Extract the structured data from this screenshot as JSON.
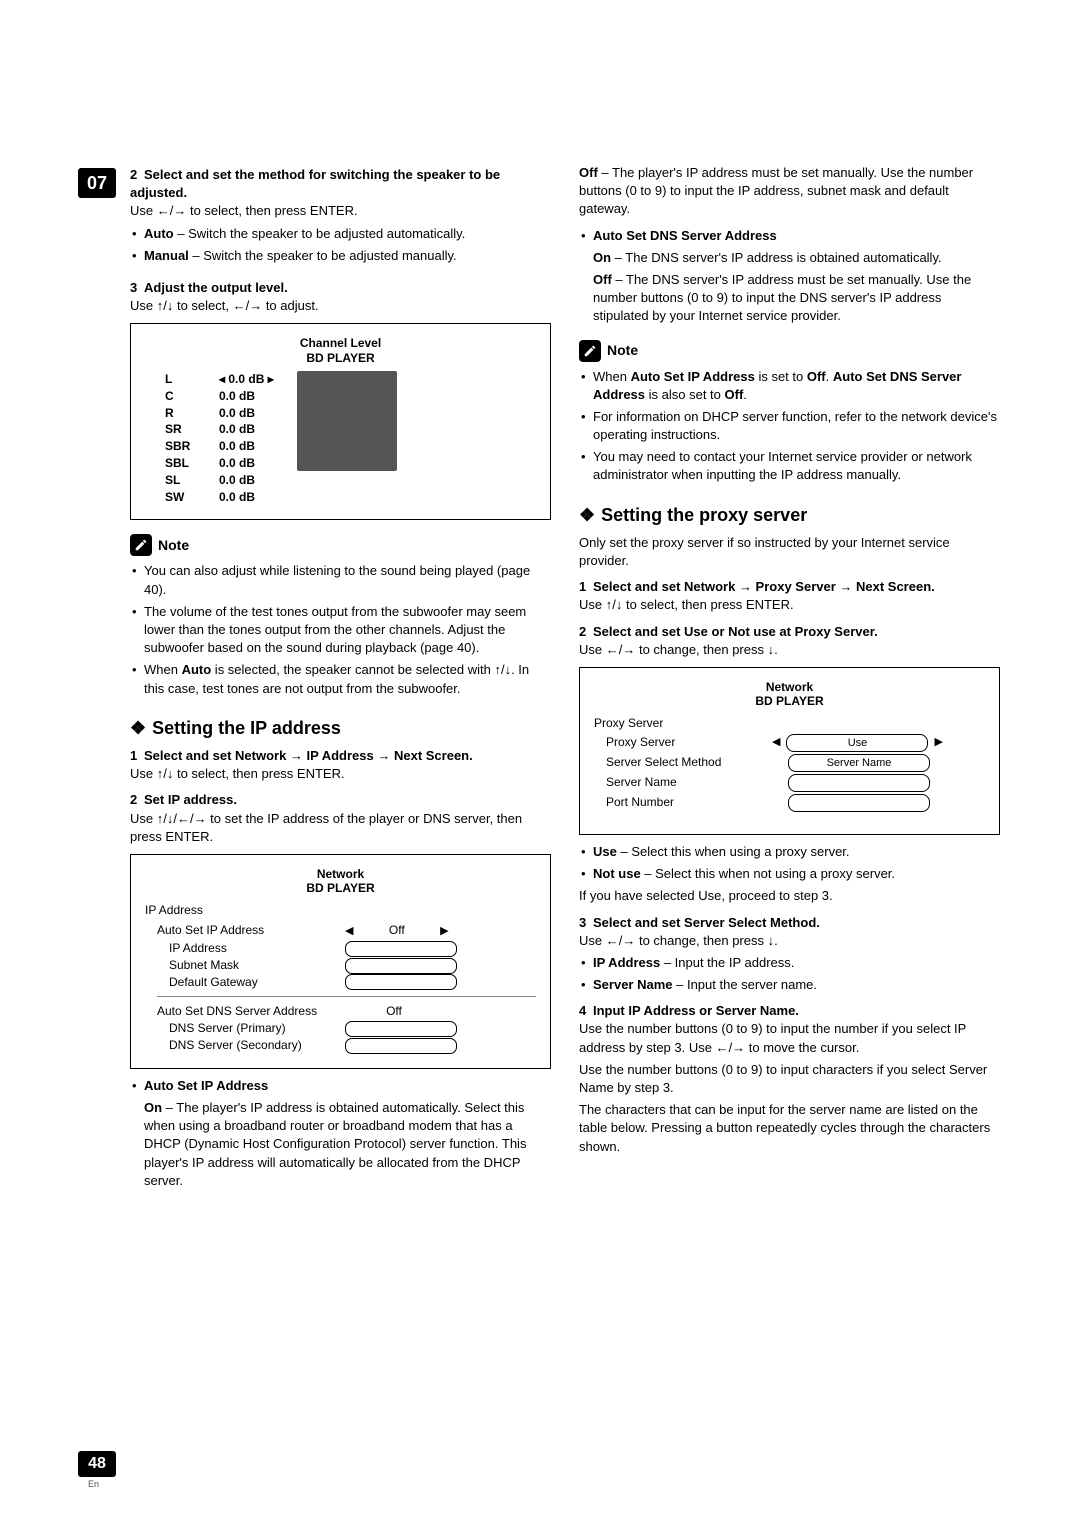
{
  "chapterNumber": "07",
  "pageNumber": "48",
  "pageLang": "En",
  "left": {
    "step2": {
      "num": "2",
      "title": "Select and set the method for switching the speaker to be adjusted."
    },
    "step2_instr": "Use ←/→ to select, then press ENTER.",
    "auto": {
      "label": "Auto",
      "desc": " – Switch the speaker to be adjusted automatically."
    },
    "manual": {
      "label": "Manual",
      "desc": " – Switch the speaker to be adjusted manually."
    },
    "step3": {
      "num": "3",
      "title": "Adjust the output level."
    },
    "step3_instr": "Use ↑/↓ to select, ←/→ to adjust.",
    "osd1": {
      "title1": "Channel Level",
      "title2": "BD PLAYER",
      "rows": [
        {
          "ch": "L",
          "val": "◂ 0.0 dB ▸"
        },
        {
          "ch": "C",
          "val": "0.0 dB"
        },
        {
          "ch": "R",
          "val": "0.0 dB"
        },
        {
          "ch": "SR",
          "val": "0.0 dB"
        },
        {
          "ch": "SBR",
          "val": "0.0 dB"
        },
        {
          "ch": "SBL",
          "val": "0.0 dB"
        },
        {
          "ch": "SL",
          "val": "0.0 dB"
        },
        {
          "ch": "SW",
          "val": "0.0 dB"
        }
      ]
    },
    "noteLabel": "Note",
    "note_b1": "You can also adjust while listening to the sound being played (page 40).",
    "note_b2": "The volume of the test tones output from the subwoofer may seem lower than the tones output from the other channels. Adjust the subwoofer based on the sound during playback (page 40).",
    "note_b3_a": "When ",
    "note_b3_b": "Auto",
    "note_b3_c": " is selected, the speaker cannot be selected with ↑/↓. In this case, test tones are not output from the subwoofer.",
    "h_ip": "Setting the IP address",
    "ip_s1": {
      "num": "1",
      "title": "Select and set Network → IP Address → Next Screen."
    },
    "ip_s1_instr": "Use ↑/↓ to select, then press ENTER.",
    "ip_s2": {
      "num": "2",
      "title": "Set IP address."
    },
    "ip_s2_instr": "Use ↑/↓/←/→ to set the IP address of the player or DNS server, then press ENTER.",
    "osd2": {
      "title1": "Network",
      "title2": "BD PLAYER",
      "group": "IP Address",
      "r1": "Auto Set IP Address",
      "r1v": "Off",
      "r2": "IP Address",
      "r3": "Subnet Mask",
      "r4": "Default Gateway",
      "r5": "Auto Set DNS Server Address",
      "r5v": "Off",
      "r6": "DNS Server (Primary)",
      "r7": "DNS Server (Secondary)"
    },
    "autosetip_label": "Auto Set IP Address",
    "on_label": "On",
    "on_desc": " – The player's IP address is obtained automatically. Select this when using a broadband router or broadband modem that has a DHCP (Dynamic Host Configuration Protocol) server function. This player's IP address will automatically be allocated from the DHCP server."
  },
  "right": {
    "off_label": "Off",
    "off_desc": " – The player's IP address must be set manually. Use the number buttons (0 to 9) to input the IP address, subnet mask and default gateway.",
    "dns_label": "Auto Set DNS Server Address",
    "dns_on": "On",
    "dns_on_desc": " – The DNS server's IP address is obtained automatically.",
    "dns_off": "Off",
    "dns_off_desc": " – The DNS server's IP address must be set manually. Use the number buttons (0 to 9) to input the DNS server's IP address stipulated by your Internet service provider.",
    "noteLabel": "Note",
    "n1_a": "When ",
    "n1_b": "Auto Set IP Address",
    "n1_c": " is set to ",
    "n1_d": "Off",
    "n1_e": ". ",
    "n1_f": "Auto Set DNS Server Address",
    "n1_g": " is also set to ",
    "n1_h": "Off",
    "n1_i": ".",
    "n2": "For information on DHCP server function, refer to the network device's operating instructions.",
    "n3": "You may need to contact your Internet service provider or network administrator when inputting the IP address manually.",
    "h_proxy": "Setting the proxy server",
    "proxy_intro": "Only set the proxy server if so instructed by your Internet service provider.",
    "p_s1": {
      "num": "1",
      "title": "Select and set Network → Proxy Server → Next Screen."
    },
    "p_s1_instr": "Use ↑/↓ to select, then press ENTER.",
    "p_s2": {
      "num": "2",
      "title": "Select and set Use or Not use at Proxy Server."
    },
    "p_s2_instr": "Use ←/→ to change, then press ↓.",
    "osd3": {
      "title1": "Network",
      "title2": "BD PLAYER",
      "group": "Proxy Server",
      "r1": "Proxy Server",
      "r1v": "Use",
      "r2": "Server Select Method",
      "r2v": "Server Name",
      "r3": "Server Name",
      "r4": "Port Number"
    },
    "use_label": "Use",
    "use_desc": " – Select this when using a proxy server.",
    "notuse_label": "Not use",
    "notuse_desc": " – Select this when not using a proxy server.",
    "ifuse": "If you have selected Use, proceed to step 3.",
    "p_s3": {
      "num": "3",
      "title": "Select and set Server Select Method."
    },
    "p_s3_instr": "Use ←/→ to change, then press ↓.",
    "ipaddr_label": "IP Address",
    "ipaddr_desc": " – Input the IP address.",
    "sname_label": "Server Name",
    "sname_desc": " – Input the server name.",
    "p_s4": {
      "num": "4",
      "title": "Input IP Address or Server Name."
    },
    "p_s4_p1": "Use the number buttons (0 to 9) to input the number if you select IP address by step 3. Use ←/→ to move the cursor.",
    "p_s4_p2": "Use the number buttons (0 to 9) to input characters if you select Server Name by step 3.",
    "p_s4_p3": "The characters that can be input for the server name are listed on the table below. Pressing a button repeatedly cycles through the characters shown."
  }
}
